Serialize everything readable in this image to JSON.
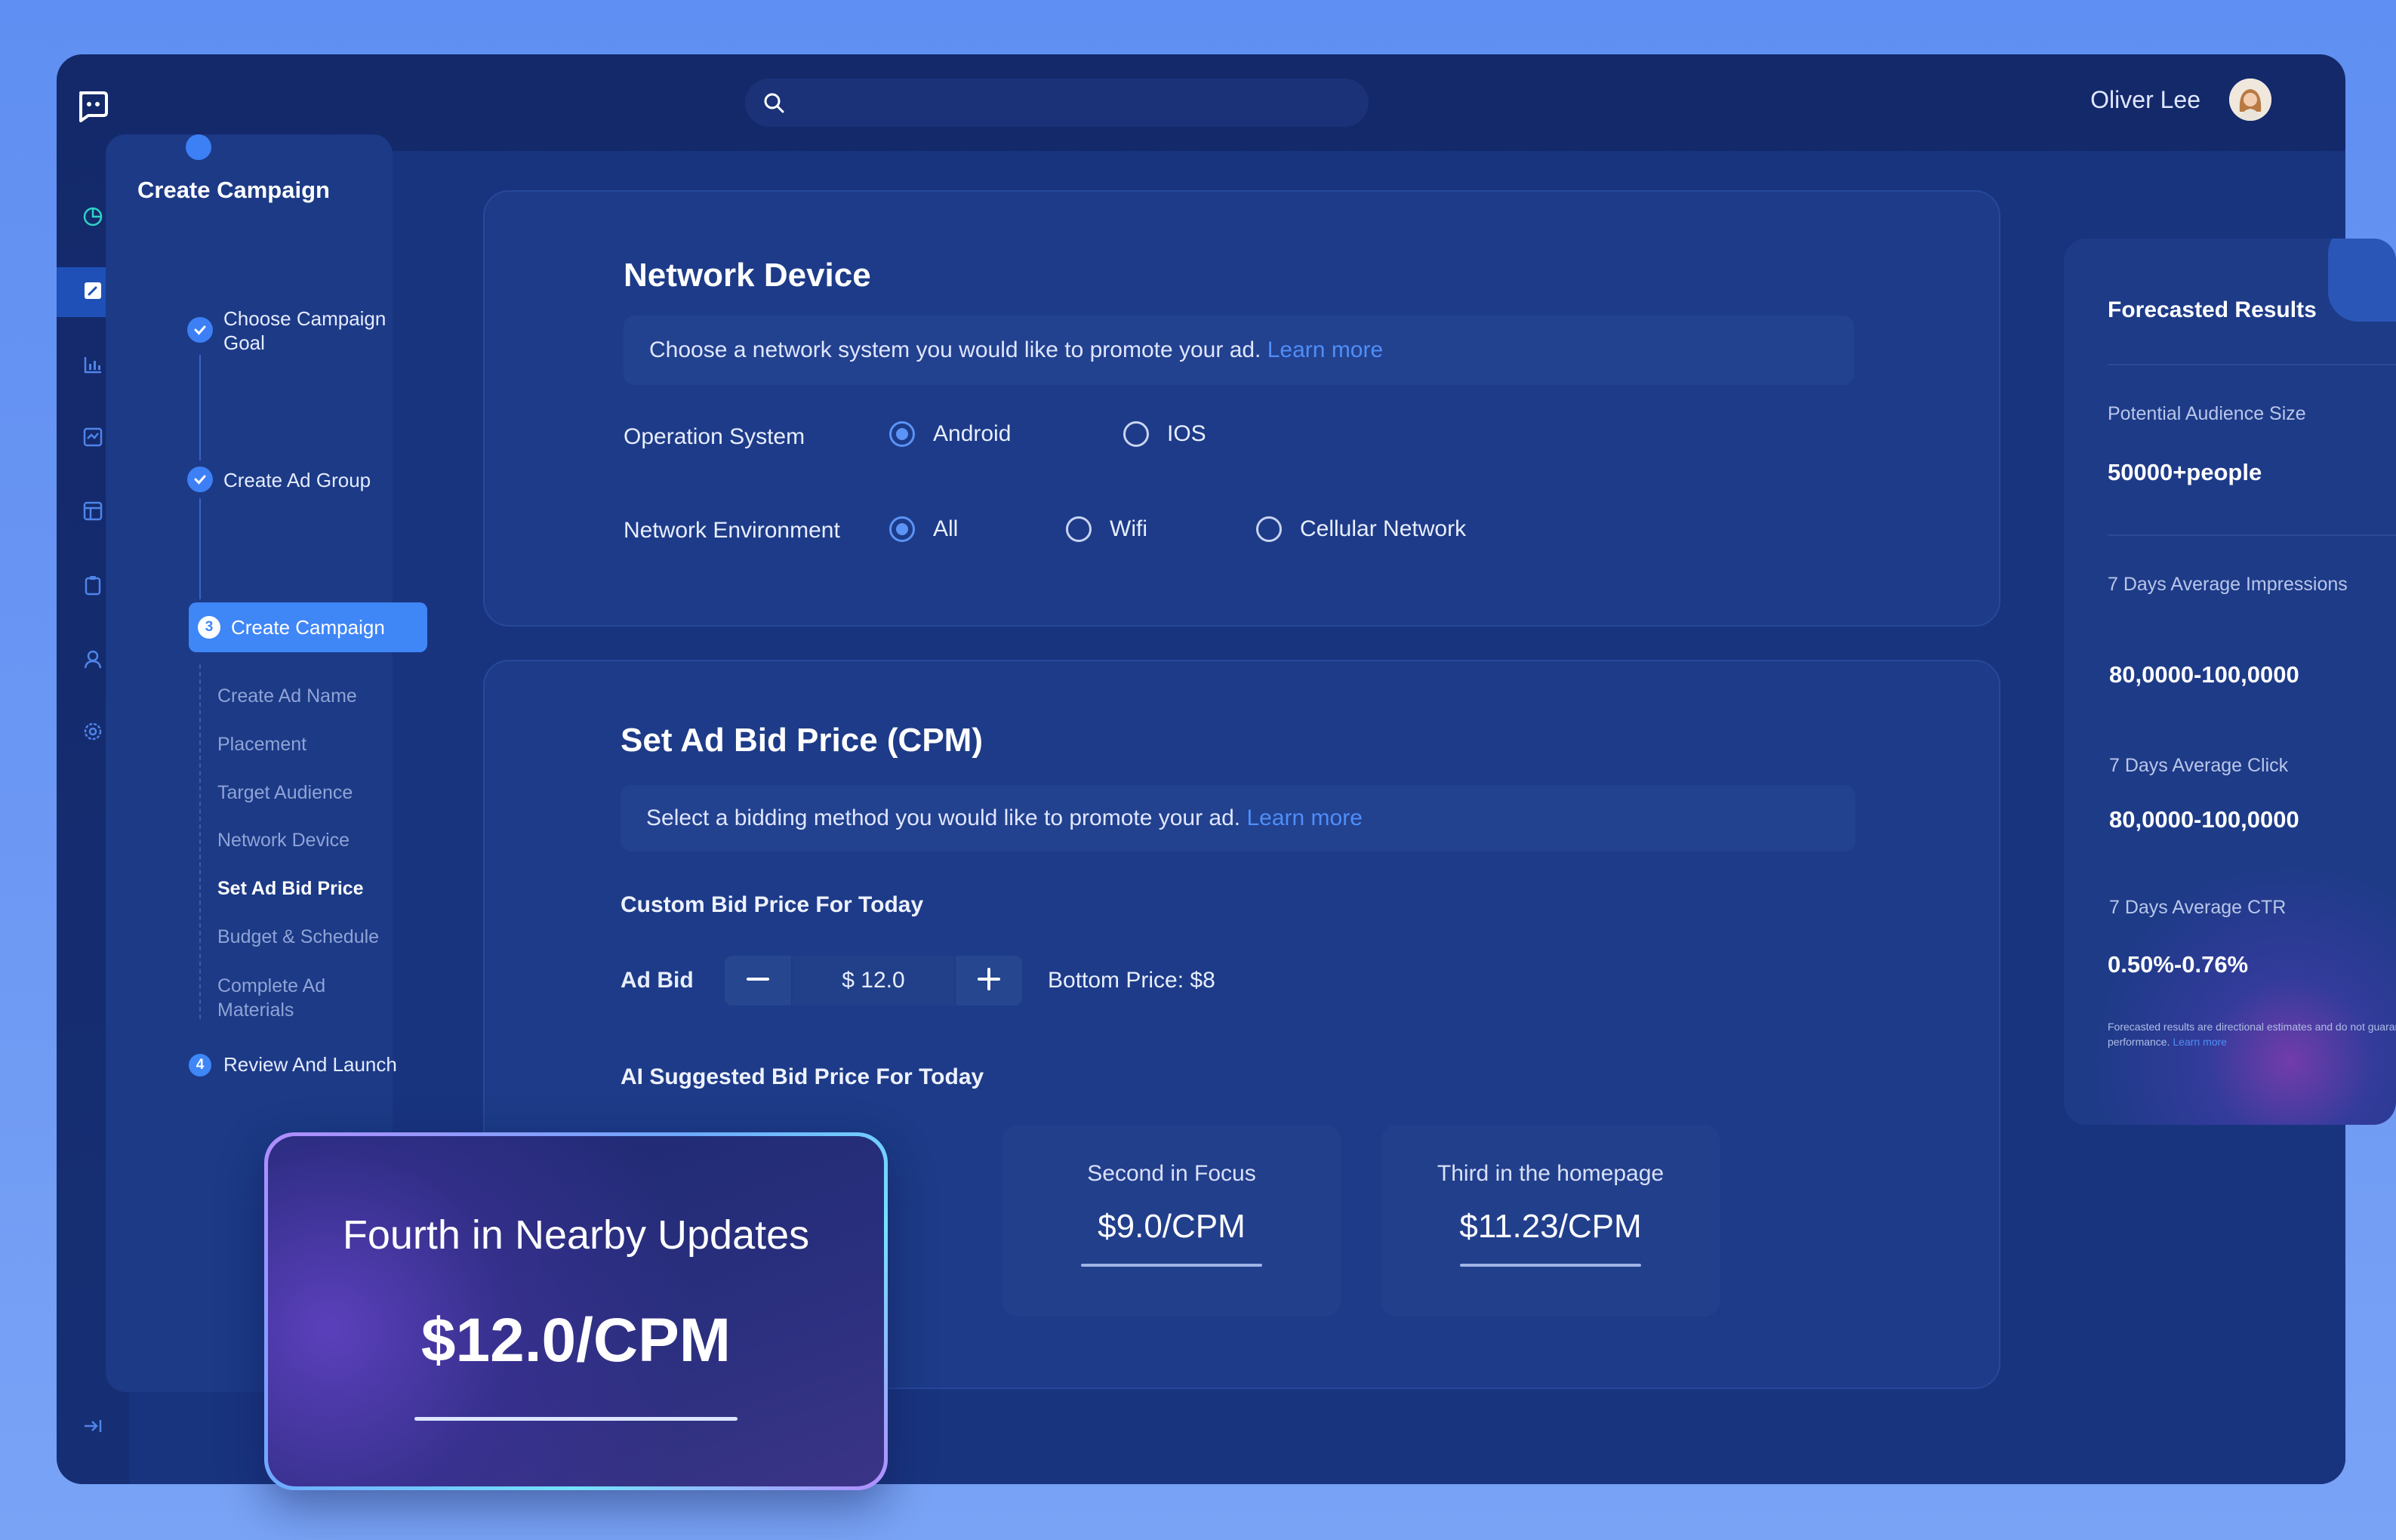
{
  "user": {
    "name": "Oliver Lee"
  },
  "search": {
    "placeholder": ""
  },
  "steps": {
    "title": "Create Campaign",
    "items": [
      {
        "label": "Choose Campaign Goal"
      },
      {
        "label": "Create Ad Group"
      },
      {
        "number": "3",
        "label": "Create Campaign"
      },
      {
        "number": "4",
        "label": "Review And Launch"
      }
    ],
    "substeps": [
      "Create Ad Name",
      "Placement",
      "Target Audience",
      "Network Device",
      "Set Ad Bid Price",
      "Budget & Schedule",
      "Complete Ad Materials"
    ]
  },
  "network": {
    "title": "Network Device",
    "info": "Choose a network system you would like to promote your ad.",
    "learn_more": "Learn more",
    "os_label": "Operation System",
    "os_options": [
      "Android",
      "IOS"
    ],
    "env_label": "Network Environment",
    "env_options": [
      "All",
      "Wifi",
      "Cellular Network"
    ]
  },
  "bid": {
    "title": "Set Ad Bid Price (CPM)",
    "info": "Select a bidding method you would like to promote your ad.",
    "learn_more": "Learn more",
    "custom_label": "Custom Bid Price For Today",
    "ad_bid_label": "Ad Bid",
    "value": "$ 12.0",
    "bottom_price": "Bottom Price: $8",
    "ai_label": "AI Suggested Bid Price For Today",
    "suggestions": [
      {
        "name": "Second in Focus",
        "price": "$9.0/CPM"
      },
      {
        "name": "Third in the homepage",
        "price": "$11.23/CPM"
      }
    ]
  },
  "highlight": {
    "name": "Fourth in Nearby Updates",
    "price": "$12.0/CPM"
  },
  "forecast": {
    "title": "Forecasted Results",
    "audience_label": "Potential Audience Size",
    "audience_value": "50000+people",
    "impressions_label": "7 Days Average Impressions",
    "impressions_value": "80,0000-100,0000",
    "click_label": "7 Days Average Click",
    "click_value": "80,0000-100,0000",
    "ctr_label": "7 Days Average CTR",
    "ctr_value": "0.50%-0.76%",
    "note": "Forecasted results are directional estimates and do not guarantee performance.",
    "note_link": "Learn more"
  },
  "colors": {
    "accent": "#3f86f7",
    "link": "#4f8ef7",
    "background": "#152c70"
  },
  "icons": {
    "rail": [
      "pie-chart-icon",
      "edit-icon",
      "bar-chart-icon",
      "activity-icon",
      "layout-icon",
      "clipboard-icon",
      "user-icon",
      "settings-icon"
    ],
    "bottom": "collapse-icon"
  }
}
